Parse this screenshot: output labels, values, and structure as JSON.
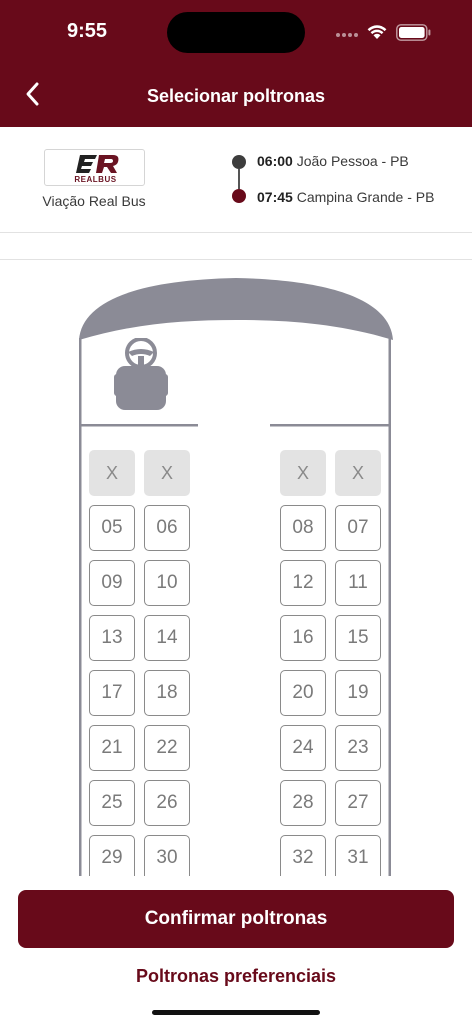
{
  "status_bar": {
    "time": "9:55"
  },
  "header": {
    "title": "Selecionar poltronas",
    "back_icon": "chevron-left-icon"
  },
  "trip": {
    "logo_text": "REALBUS",
    "company": "Viação Real Bus",
    "departure": {
      "time": "06:00",
      "place": "João Pessoa - PB"
    },
    "arrival": {
      "time": "07:45",
      "place": "Campina Grande - PB"
    }
  },
  "colors": {
    "brand": "#680a1a",
    "seat_border": "#8a8a8a",
    "bus_body": "#8b8b96"
  },
  "seats": {
    "left": [
      [
        "X",
        "X"
      ],
      [
        "05",
        "06"
      ],
      [
        "09",
        "10"
      ],
      [
        "13",
        "14"
      ],
      [
        "17",
        "18"
      ],
      [
        "21",
        "22"
      ],
      [
        "25",
        "26"
      ],
      [
        "29",
        "30"
      ]
    ],
    "right": [
      [
        "X",
        "X"
      ],
      [
        "08",
        "07"
      ],
      [
        "12",
        "11"
      ],
      [
        "16",
        "15"
      ],
      [
        "20",
        "19"
      ],
      [
        "24",
        "23"
      ],
      [
        "28",
        "27"
      ],
      [
        "32",
        "31"
      ]
    ]
  },
  "footer": {
    "confirm_label": "Confirmar poltronas",
    "preferential_label": "Poltronas preferenciais"
  }
}
